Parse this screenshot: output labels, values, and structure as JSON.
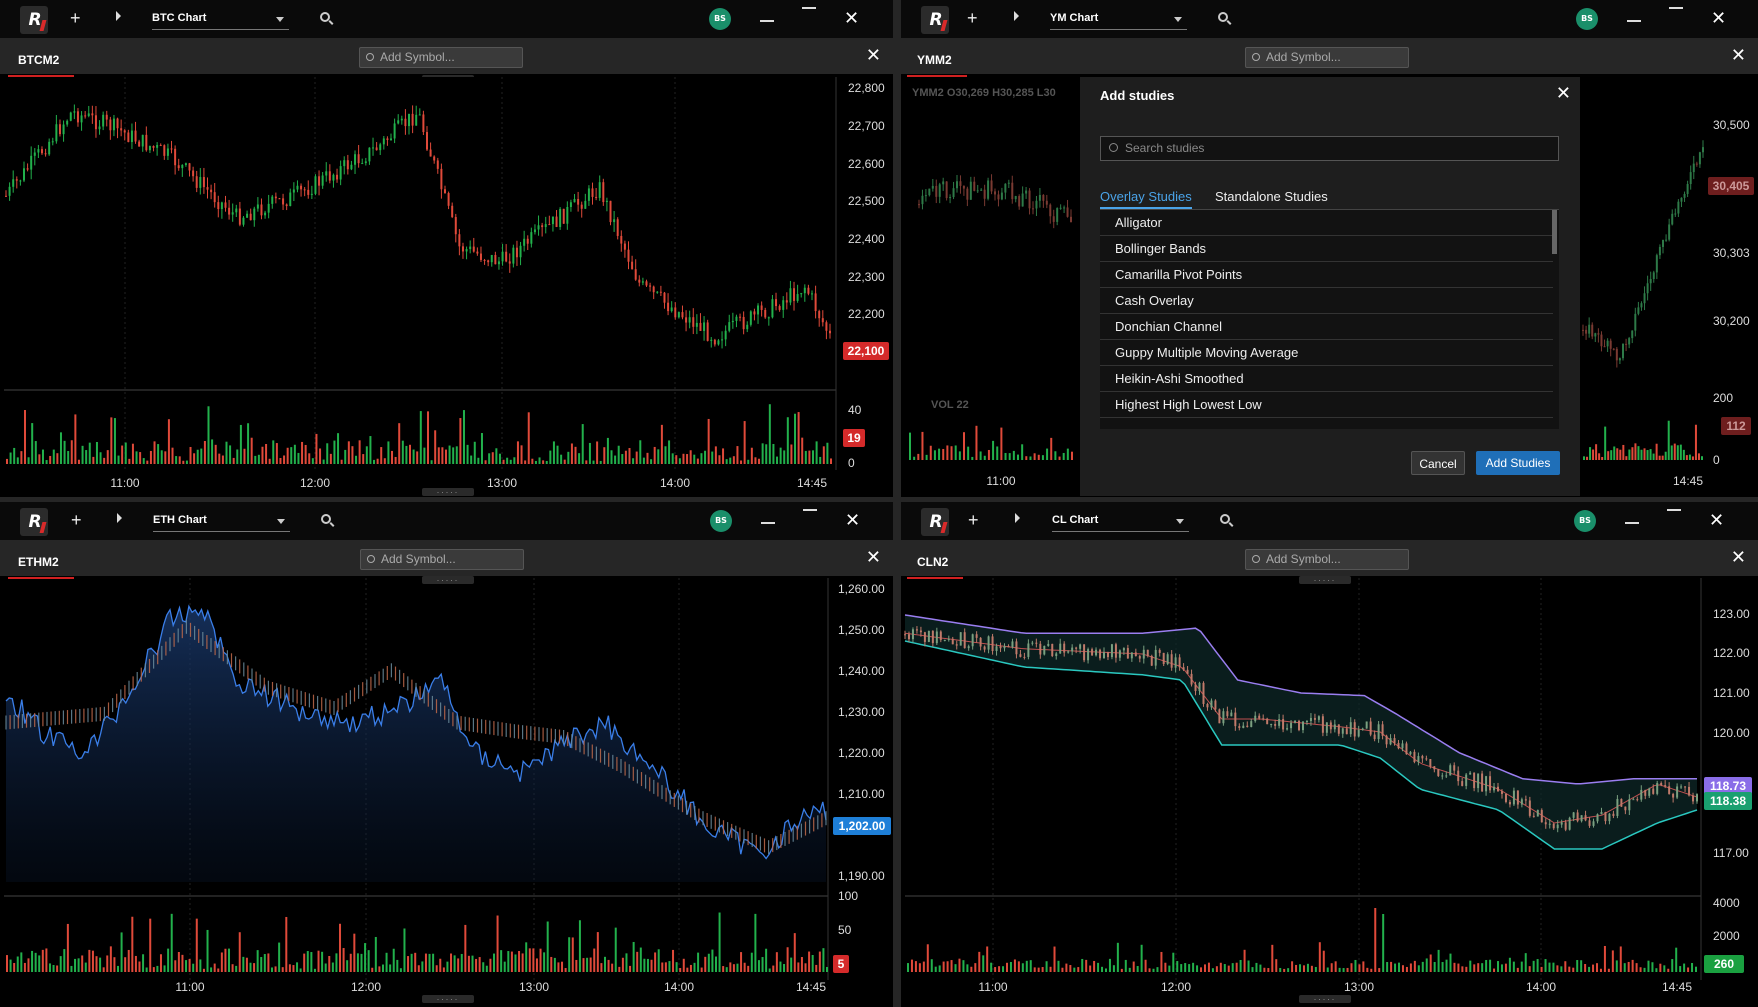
{
  "windows": [
    {
      "id": "btc",
      "chart_label": "BTC Chart",
      "symbol": "BTCM2",
      "add_symbol": "Add Symbol...",
      "avatar": "BS",
      "price_ticks": [
        "22,800",
        "22,700",
        "22,600",
        "22,500",
        "22,400",
        "22,300",
        "22,200"
      ],
      "last_price": "22,100",
      "vol_ticks": [
        "40",
        "0"
      ],
      "vol_last": "19",
      "time_ticks": [
        "11:00",
        "12:00",
        "13:00",
        "14:00",
        "14:45"
      ]
    },
    {
      "id": "ym",
      "chart_label": "YM Chart",
      "symbol": "YMM2",
      "add_symbol": "Add Symbol...",
      "avatar": "BS",
      "ohlc": "YMM2 O30,269 H30,285 L30",
      "price_ticks": [
        "30,500",
        "30,303",
        "30,200"
      ],
      "last_price": "30,405",
      "vol_label": "VOL 22",
      "vol_ticks": [
        "200",
        "0"
      ],
      "vol_last": "112",
      "time_ticks": [
        "11:00",
        "14:45"
      ]
    },
    {
      "id": "eth",
      "chart_label": "ETH Chart",
      "symbol": "ETHM2",
      "add_symbol": "Add Symbol...",
      "avatar": "BS",
      "price_ticks": [
        "1,260.00",
        "1,250.00",
        "1,240.00",
        "1,230.00",
        "1,220.00",
        "1,210.00",
        "1,190.00"
      ],
      "last_price": "1,202.00",
      "vol_ticks": [
        "100",
        "50"
      ],
      "vol_last": "5",
      "time_ticks": [
        "11:00",
        "12:00",
        "13:00",
        "14:00",
        "14:45"
      ]
    },
    {
      "id": "cl",
      "chart_label": "CL Chart",
      "symbol": "CLN2",
      "add_symbol": "Add Symbol...",
      "avatar": "BS",
      "price_ticks": [
        "123.00",
        "122.00",
        "121.00",
        "120.00",
        "117.00"
      ],
      "last_price": "118.38",
      "band_upper": "118.73",
      "vol_ticks": [
        "4000",
        "2000"
      ],
      "vol_last": "260",
      "time_ticks": [
        "11:00",
        "12:00",
        "13:00",
        "14:00",
        "14:45"
      ]
    }
  ],
  "modal": {
    "title": "Add studies",
    "search_placeholder": "Search studies",
    "tabs": [
      "Overlay Studies",
      "Standalone Studies"
    ],
    "items": [
      "Alligator",
      "Bollinger Bands",
      "Camarilla Pivot Points",
      "Cash Overlay",
      "Donchian Channel",
      "Guppy Multiple Moving Average",
      "Heikin-Ashi Smoothed",
      "Highest High Lowest Low"
    ],
    "cancel": "Cancel",
    "add": "Add Studies"
  },
  "colors": {
    "up": "#22b14c",
    "down": "#e04a3a",
    "accent": "#1f6fb8",
    "badge": "#1a8f6a"
  }
}
